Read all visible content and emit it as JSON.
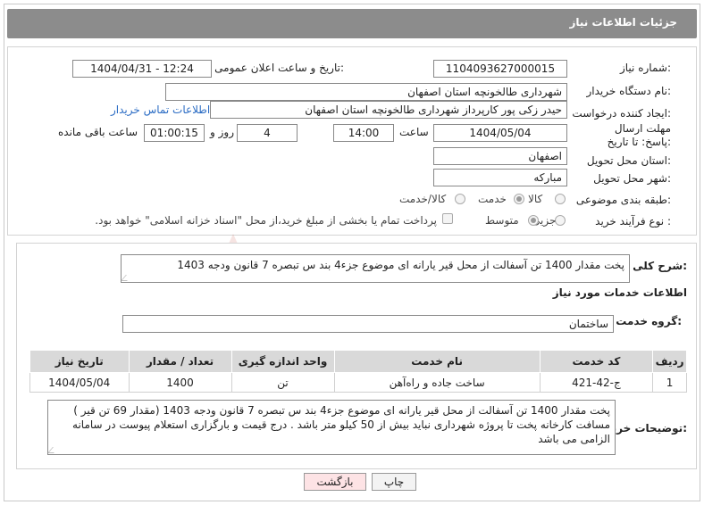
{
  "header": {
    "title": "جزئیات اطلاعات نیاز"
  },
  "fields": {
    "need_number_label": "شماره نیاز:",
    "need_number": "1104093627000015",
    "announce_label": "تاریخ و ساعت اعلان عمومی:",
    "announce_value": "1404/04/31 - 12:24",
    "buyer_org_label": "نام دستگاه خریدار:",
    "buyer_org": "شهرداری طالخونچه استان اصفهان",
    "creator_label": "ایجاد کننده درخواست:",
    "creator": "حیدر زکی پور کارپرداز شهرداری طالخونچه استان اصفهان",
    "contact_link": "اطلاعات تماس خریدار",
    "deadline_label": "مهلت ارسال پاسخ: تا تاریخ:",
    "deadline_date": "1404/05/04",
    "time_label": "ساعت",
    "deadline_time": "14:00",
    "days_value": "4",
    "days_label": "روز و",
    "remaining_time": "01:00:15",
    "remaining_label": "ساعت باقی مانده",
    "province_label": "استان محل تحویل:",
    "province": "اصفهان",
    "city_label": "شهر محل تحویل:",
    "city": "مبارکه",
    "category_label": "طبقه بندی موضوعی:",
    "category_options": [
      "کالا",
      "خدمت",
      "کالا/خدمت"
    ],
    "category_selected": "خدمت",
    "process_label": "نوع فرآیند خرید :",
    "process_options": [
      "جزیی",
      "متوسط"
    ],
    "process_selected": "جزیی",
    "payment_note": "پرداخت تمام یا بخشی از مبلغ خرید،از محل \"اسناد خزانه اسلامی\" خواهد بود."
  },
  "details": {
    "summary_label": "شرح کلی نیاز:",
    "summary": "پخت مقدار 1400 تن آسفالت از محل قیر یارانه ای موضوع جزء4 بند س تبصره 7 قانون ودجه 1403",
    "services_title": "اطلاعات خدمات مورد نیاز",
    "group_label": "گروه خدمت:",
    "group_value": "ساختمان",
    "table": {
      "headers": [
        "ردیف",
        "کد خدمت",
        "نام خدمت",
        "واحد اندازه گیری",
        "تعداد / مقدار",
        "تاریخ نیاز"
      ],
      "rows": [
        [
          "1",
          "ج-42-421",
          "ساخت جاده و راه‌آهن",
          "تن",
          "1400",
          "1404/05/04"
        ]
      ]
    },
    "buyer_notes_label": "توضیحات خریدار:",
    "buyer_notes": "پخت مقدار 1400 تن آسفالت از محل قیر یارانه ای موضوع جزء4 بند س تبصره 7 قانون ودجه 1403 (مقدار 69 تن قیر ) مسافت کارخانه  پخت تا پروژه شهرداری نباید بیش از 50 کیلو متر باشد . درج قیمت و بارگزاری استعلام پیوست در سامانه الزامی می باشد"
  },
  "buttons": {
    "print": "چاپ",
    "back": "بازگشت"
  },
  "watermark": {
    "text": "AriaTender.net"
  },
  "colors": {
    "title_bg": "#8c8c8c",
    "link": "#2b6cc4",
    "back_btn": "#fde3e5",
    "table_header": "#d9d9d9",
    "watermark": "#c0392b"
  }
}
